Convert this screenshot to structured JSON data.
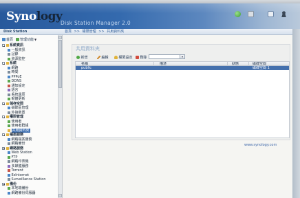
{
  "app": {
    "logo_part1": "Syno",
    "logo_part2": "logy",
    "title": "Disk Station Manager 2.0"
  },
  "header": {
    "icons": [
      "status-icon",
      "display-icon",
      "help-icon",
      "user-icon"
    ]
  },
  "nav": {
    "station_label": "Disk Station",
    "breadcrumb": [
      "首頁",
      "權限管理",
      "共用資料夾"
    ],
    "separator": ">>"
  },
  "sidebar": {
    "home_label": "首頁",
    "module_label": "管理功能",
    "items": [
      {
        "label": "系統資訊",
        "type": "group"
      },
      {
        "label": "一般資訊"
      },
      {
        "label": "記錄"
      },
      {
        "label": "資源監控"
      },
      {
        "label": "系統",
        "type": "group"
      },
      {
        "label": "網路"
      },
      {
        "label": "時間"
      },
      {
        "label": "PPPoE"
      },
      {
        "label": "DDNS"
      },
      {
        "label": "通知設定"
      },
      {
        "label": "語言"
      },
      {
        "label": "系統還原"
      },
      {
        "label": "韌體更新"
      },
      {
        "label": "儲存空間",
        "type": "group"
      },
      {
        "label": "磁碟區管理"
      },
      {
        "label": "外接裝置"
      },
      {
        "label": "權限管理",
        "type": "group"
      },
      {
        "label": "使用者"
      },
      {
        "label": "使用者群組"
      },
      {
        "label": "共用資料夾",
        "selected": true
      },
      {
        "label": "檔案服務",
        "type": "group"
      },
      {
        "label": "網路檔案服務"
      },
      {
        "label": "網路備份"
      },
      {
        "label": "網路服務",
        "type": "group"
      },
      {
        "label": "Web Station"
      },
      {
        "label": "FTP"
      },
      {
        "label": "網路印表機"
      },
      {
        "label": "多媒體服務"
      },
      {
        "label": "Torrent"
      },
      {
        "label": "EzInternet"
      },
      {
        "label": "Surveillance Station"
      },
      {
        "label": "備份",
        "type": "group"
      },
      {
        "label": "本地端備份"
      },
      {
        "label": "網路備份伺服器"
      }
    ]
  },
  "panel": {
    "title": "共用資料夾",
    "toolbar": {
      "add": "新增",
      "edit": "編輯",
      "permissions": "權限設定",
      "delete": "刪除",
      "search_dropdown": "▾"
    },
    "columns": [
      "名稱",
      "描述",
      "狀態",
      "磁碟空間"
    ],
    "rows": [
      {
        "name": "public",
        "volume": "磁碟空間 1",
        "selected": true
      }
    ]
  },
  "footer": {
    "link": "www.synology.com"
  },
  "colors": {
    "header_blue": "#28599c",
    "selection_blue": "#3a6caf",
    "panel_title": "#8ba7c8",
    "link": "#3c66a9"
  }
}
